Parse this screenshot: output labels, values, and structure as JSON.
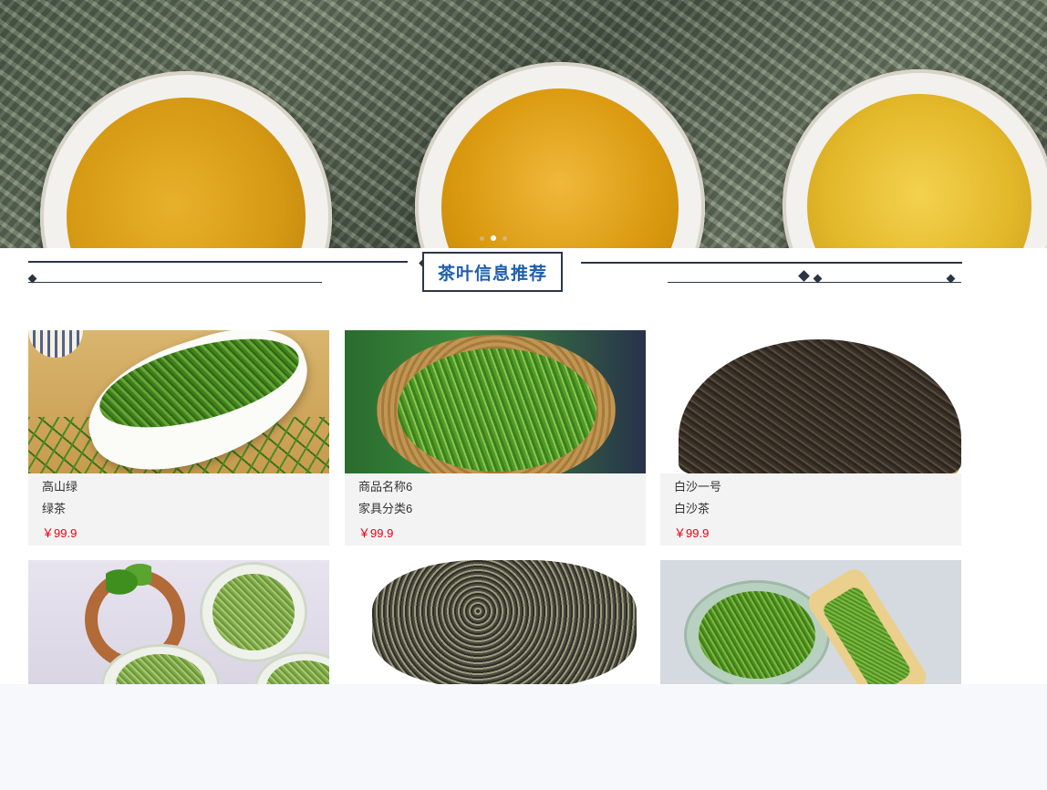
{
  "banner": {
    "slides": 3,
    "active_slide": 2
  },
  "section": {
    "title": "茶叶信息推荐"
  },
  "products": [
    {
      "name": "高山绿",
      "category": "绿茶",
      "price": "￥99.9"
    },
    {
      "name": "商品名称6",
      "category": "家具分类6",
      "price": "￥99.9"
    },
    {
      "name": "白沙一号",
      "category": "白沙茶",
      "price": "￥99.9"
    }
  ],
  "colors": {
    "heading_text": "#1f5fae",
    "heading_border": "#2d3646",
    "price": "#e60012",
    "card_bg": "#f3f3f3",
    "footer_bg": "#f6f8fc"
  }
}
